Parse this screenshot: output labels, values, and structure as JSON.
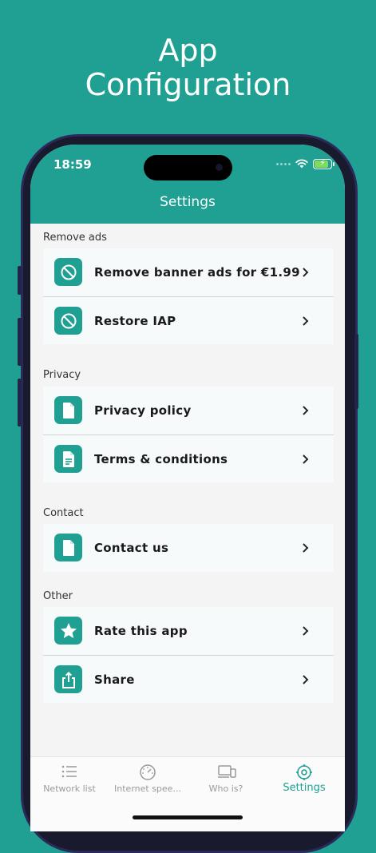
{
  "headline": {
    "line1": "App",
    "line2": "Configuration"
  },
  "status": {
    "time": "18:59"
  },
  "nav": {
    "title": "Settings"
  },
  "sections": [
    {
      "label": "Remove ads",
      "items": [
        {
          "label": "Remove banner ads for €1.99",
          "icon": "block-icon"
        },
        {
          "label": "Restore IAP",
          "icon": "block-icon"
        }
      ]
    },
    {
      "label": "Privacy",
      "items": [
        {
          "label": "Privacy policy",
          "icon": "document-icon"
        },
        {
          "label": "Terms & conditions",
          "icon": "document-lines-icon"
        }
      ]
    },
    {
      "label": "Contact",
      "items": [
        {
          "label": "Contact us",
          "icon": "document-icon"
        }
      ]
    },
    {
      "label": "Other",
      "items": [
        {
          "label": "Rate this app",
          "icon": "star-icon"
        },
        {
          "label": "Share",
          "icon": "share-icon"
        }
      ]
    }
  ],
  "tabs": [
    {
      "label": "Network list",
      "icon": "list-icon"
    },
    {
      "label": "Internet spee...",
      "icon": "speedometer-icon"
    },
    {
      "label": "Who is?",
      "icon": "devices-icon"
    },
    {
      "label": "Settings",
      "icon": "settings-icon"
    }
  ],
  "colors": {
    "accent": "#1fa093",
    "background": "#f4f4f4",
    "text": "#1a1a1a"
  }
}
